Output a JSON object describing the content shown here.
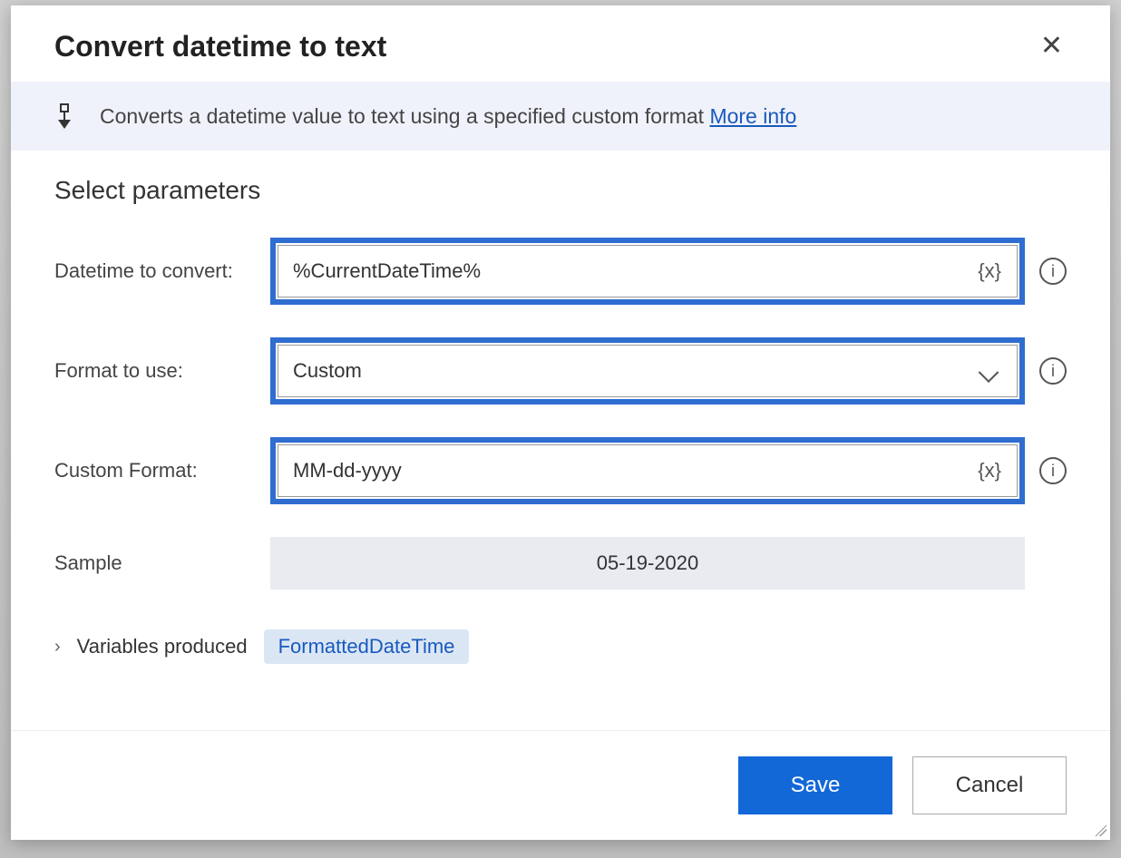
{
  "dialog": {
    "title": "Convert datetime to text",
    "description": "Converts a datetime value to text using a specified custom format",
    "more_info_label": "More info"
  },
  "section_title": "Select parameters",
  "params": {
    "datetime_label": "Datetime to convert:",
    "datetime_value": "%CurrentDateTime%",
    "var_suffix": "{x}",
    "format_label": "Format to use:",
    "format_value": "Custom",
    "custom_label": "Custom Format:",
    "custom_value": "MM-dd-yyyy",
    "sample_label": "Sample",
    "sample_value": "05-19-2020"
  },
  "variables": {
    "toggle_label": "Variables produced",
    "chip": "FormattedDateTime"
  },
  "footer": {
    "save": "Save",
    "cancel": "Cancel"
  },
  "icons": {
    "info_glyph": "i"
  }
}
